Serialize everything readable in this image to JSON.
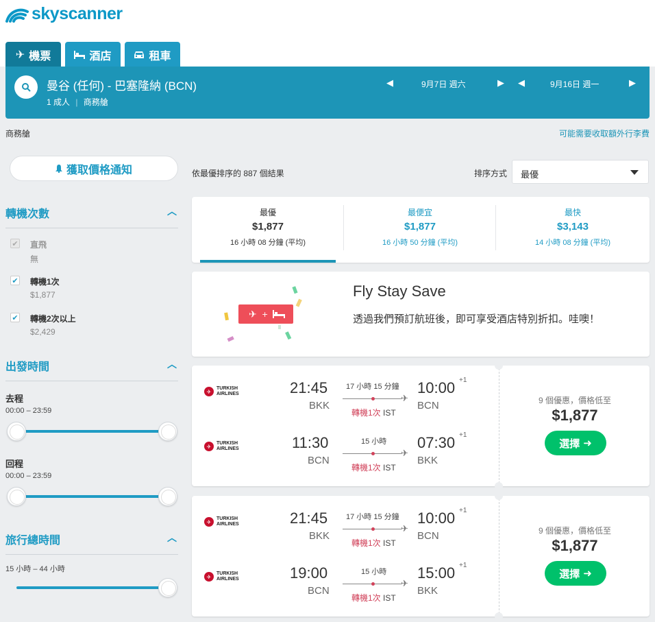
{
  "brand": {
    "name": "skyscanner"
  },
  "tabs": [
    {
      "label": "機票",
      "icon": "plane-icon",
      "active": true
    },
    {
      "label": "酒店",
      "icon": "bed-icon",
      "active": false
    },
    {
      "label": "租車",
      "icon": "car-icon",
      "active": false
    }
  ],
  "search": {
    "route": "曼谷 (任何) - 巴塞隆納 (BCN)",
    "passengers": "1 成人",
    "cabin": "商務艙",
    "depart_date": "9月7日 週六",
    "return_date": "9月16日 週一"
  },
  "cabin_label": "商務艙",
  "baggage_link": "可能需要收取額外行李費",
  "sidebar": {
    "alert_button": "獲取價格通知",
    "stops": {
      "title": "轉機次數",
      "items": [
        {
          "label": "直飛",
          "sub": "無",
          "checked": true,
          "disabled": true
        },
        {
          "label": "轉機1次",
          "sub": "$1,877",
          "checked": true,
          "disabled": false
        },
        {
          "label": "轉機2次以上",
          "sub": "$2,429",
          "checked": true,
          "disabled": false
        }
      ]
    },
    "times": {
      "title": "出發時間",
      "outbound_label": "去程",
      "outbound_range": "00:00 – 23:59",
      "return_label": "回程",
      "return_range": "00:00 – 23:59"
    },
    "duration": {
      "title": "旅行總時間",
      "range": "15 小時 – 44 小時"
    }
  },
  "results": {
    "count_text": "依最優排序的 887 個結果",
    "sort_label": "排序方式",
    "sort_value": "最優"
  },
  "summary": [
    {
      "heading": "最優",
      "price": "$1,877",
      "duration": "16 小時 08 分鐘 (平均)"
    },
    {
      "heading": "最便宜",
      "price": "$1,877",
      "duration": "16 小時 50 分鐘 (平均)"
    },
    {
      "heading": "最快",
      "price": "$3,143",
      "duration": "14 小時 08 分鐘 (平均)"
    }
  ],
  "promo": {
    "title": "Fly Stay Save",
    "text": "透過我們預訂航班後，即可享受酒店特別折扣。哇噢！"
  },
  "cards": [
    {
      "legs": [
        {
          "airline": "TURKISH AIRLINES",
          "dep_time": "21:45",
          "dep_code": "BKK",
          "duration": "17 小時 15 分鐘",
          "stops": "轉機1次",
          "via": "IST",
          "arr_time": "10:00",
          "arr_plus": "+1",
          "arr_code": "BCN"
        },
        {
          "airline": "TURKISH AIRLINES",
          "dep_time": "11:30",
          "dep_code": "BCN",
          "duration": "15 小時",
          "stops": "轉機1次",
          "via": "IST",
          "arr_time": "07:30",
          "arr_plus": "+1",
          "arr_code": "BKK"
        }
      ],
      "deals": "9 個優惠，價格低至",
      "price": "$1,877",
      "button": "選擇"
    },
    {
      "legs": [
        {
          "airline": "TURKISH AIRLINES",
          "dep_time": "21:45",
          "dep_code": "BKK",
          "duration": "17 小時 15 分鐘",
          "stops": "轉機1次",
          "via": "IST",
          "arr_time": "10:00",
          "arr_plus": "+1",
          "arr_code": "BCN"
        },
        {
          "airline": "TURKISH AIRLINES",
          "dep_time": "19:00",
          "dep_code": "BCN",
          "duration": "15 小時",
          "stops": "轉機1次",
          "via": "IST",
          "arr_time": "15:00",
          "arr_plus": "+1",
          "arr_code": "BKK"
        }
      ],
      "deals": "9 個優惠，價格低至",
      "price": "$1,877",
      "button": "選擇"
    }
  ],
  "colors": {
    "accent": "#1d95b7",
    "tab_active": "#117a99",
    "stops_red": "#d1435b",
    "select_green": "#00c16b"
  }
}
